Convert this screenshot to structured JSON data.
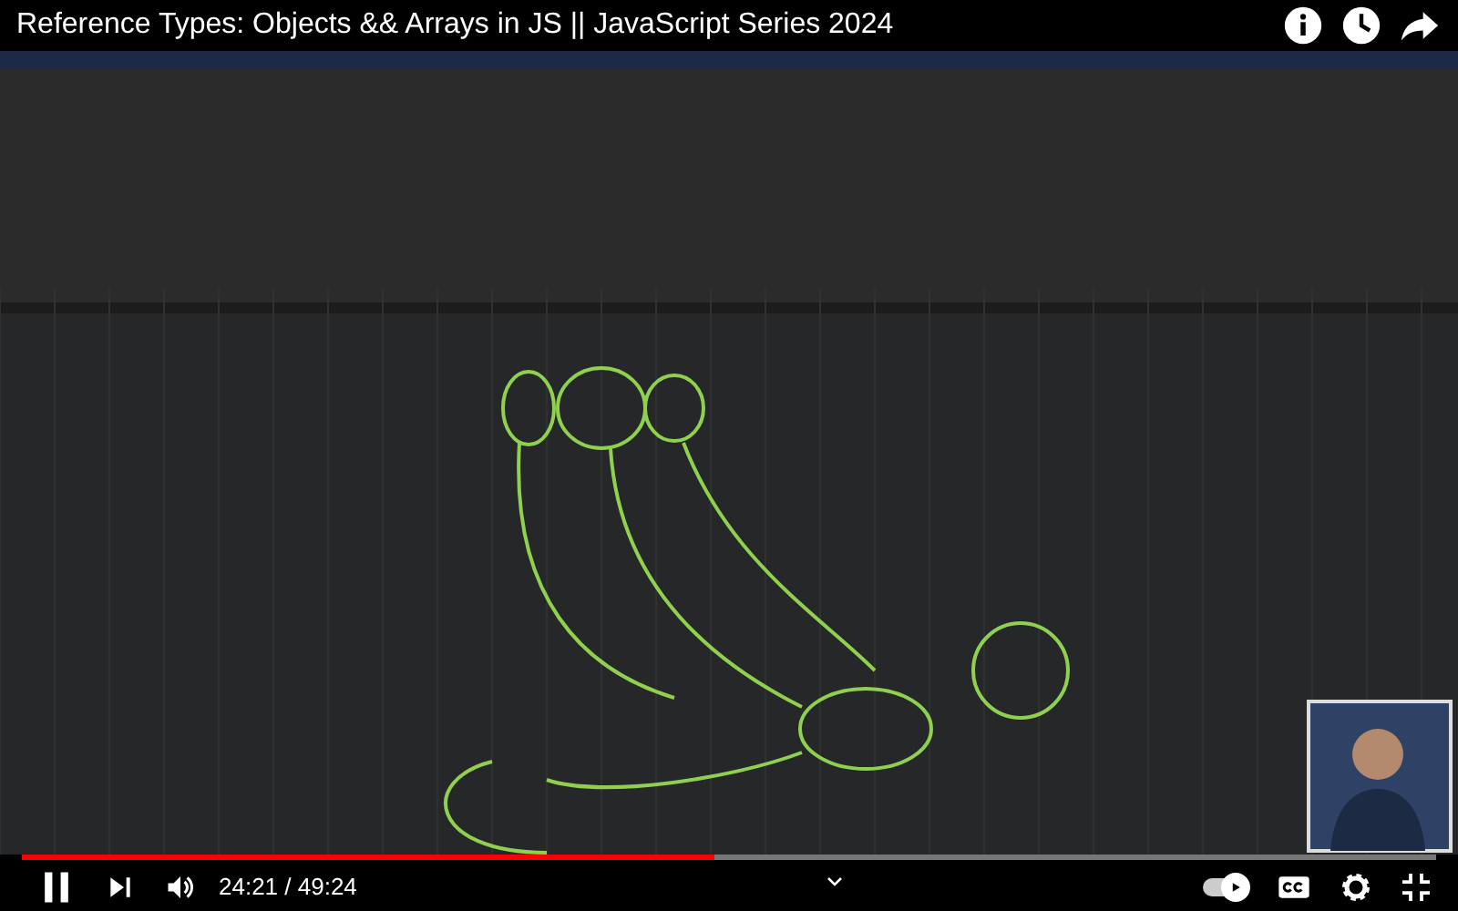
{
  "video": {
    "title": "Reference Types: Objects && Arrays in JS || JavaScript Series 2024",
    "kind": "picture"
  },
  "progress": {
    "level": 0.49
  },
  "controls": {
    "playing": true,
    "time": "24:21 / 49:24",
    "autoplay": {
      "on": true
    }
  }
}
